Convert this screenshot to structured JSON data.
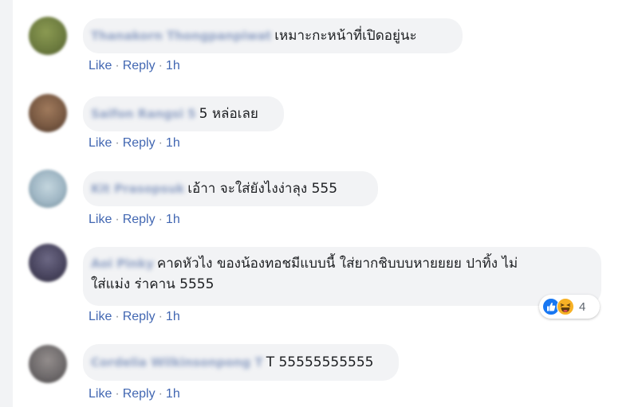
{
  "actions": {
    "like": "Like",
    "reply": "Reply",
    "separator": "·"
  },
  "comments": [
    {
      "author": "Thanakorn Thongpanpiwat",
      "text": "เหมาะกะหน้าที่เปิดอยู่นะ",
      "time": "1h",
      "avatar_color": "#6b7a3e"
    },
    {
      "author": "Saifon Rangsi 5",
      "text": "5 หล่อเลย",
      "time": "1h",
      "avatar_color": "#7a5a43"
    },
    {
      "author": "Kit Prasopsuk",
      "text": "เอ้าา จะใส่ยังไงง่าลุง 555",
      "time": "1h",
      "avatar_color": "#9fb6c4"
    },
    {
      "author": "Aoi Pinky",
      "text_lines": [
        "คาดหัวไง ของน้องทอชมีแบบนี้ ใส่ยากชิบบบหายยยย ปาทิ้ง ไม่",
        "ใส่แม่ง ร่าคาน 5555"
      ],
      "time": "1h",
      "avatar_color": "#4a4660",
      "reactions": {
        "icons": [
          "like-icon",
          "haha-icon"
        ],
        "count": "4"
      }
    },
    {
      "author": "Cordelia Wilkinsonpong T",
      "text": "T 55555555555",
      "time": "1h",
      "avatar_color": "#6f6b6c"
    }
  ]
}
